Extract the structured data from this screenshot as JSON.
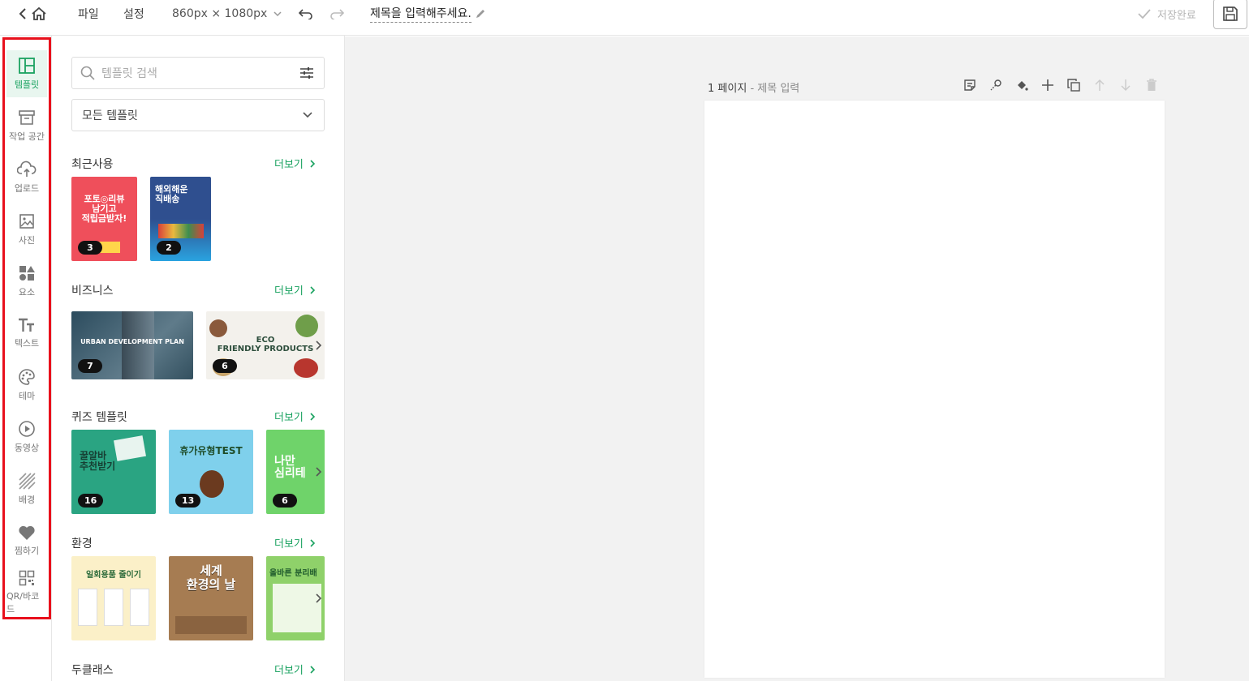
{
  "topbar": {
    "menu_file": "파일",
    "menu_settings": "설정",
    "size": "860px × 1080px",
    "title": "제목을 입력해주세요.",
    "save_status": "저장완료"
  },
  "sidebar": {
    "items": [
      {
        "label": "템플릿",
        "icon": "layout-icon",
        "active": true
      },
      {
        "label": "작업 공간",
        "icon": "archive-icon"
      },
      {
        "label": "업로드",
        "icon": "cloud-upload-icon"
      },
      {
        "label": "사진",
        "icon": "image-icon"
      },
      {
        "label": "요소",
        "icon": "shapes-icon"
      },
      {
        "label": "텍스트",
        "icon": "text-icon"
      },
      {
        "label": "테마",
        "icon": "palette-icon"
      },
      {
        "label": "동영상",
        "icon": "play-icon"
      },
      {
        "label": "배경",
        "icon": "hatch-icon"
      },
      {
        "label": "찜하기",
        "icon": "heart-icon"
      },
      {
        "label": "QR/바코드",
        "icon": "qr-icon"
      }
    ],
    "highlight_color": "#e8101c",
    "accent_color": "#1aa260"
  },
  "panel": {
    "search_placeholder": "템플릿 검색",
    "category_select": "모든 템플릿",
    "more_label": "더보기",
    "sections": [
      {
        "title": "최근사용",
        "thumbs": [
          {
            "text": "포토◎리뷰\n남기고\n적립금받자!",
            "count": "3"
          },
          {
            "text": "해외해운\n직배송",
            "count": "2"
          }
        ]
      },
      {
        "title": "비즈니스",
        "thumbs": [
          {
            "text": "URBAN DEVELOPMENT PLAN",
            "count": "7"
          },
          {
            "text": "ECO\nFRIENDLY PRODUCTS",
            "count": "6"
          }
        ]
      },
      {
        "title": "퀴즈 템플릿",
        "thumbs": [
          {
            "text": "꿀알바\n추천받기",
            "count": "16"
          },
          {
            "text": "휴가유형TEST",
            "count": "13"
          },
          {
            "text": "나만\n심리테",
            "count": "6"
          }
        ]
      },
      {
        "title": "환경",
        "thumbs": [
          {
            "text": "일회용품 줄이기"
          },
          {
            "text": "세계\n환경의 날"
          },
          {
            "text": "올바른 분리배"
          }
        ]
      },
      {
        "title": "두클래스",
        "thumbs": []
      }
    ]
  },
  "canvas": {
    "page_number": "1 페이지",
    "page_title": "- 제목 입력"
  }
}
